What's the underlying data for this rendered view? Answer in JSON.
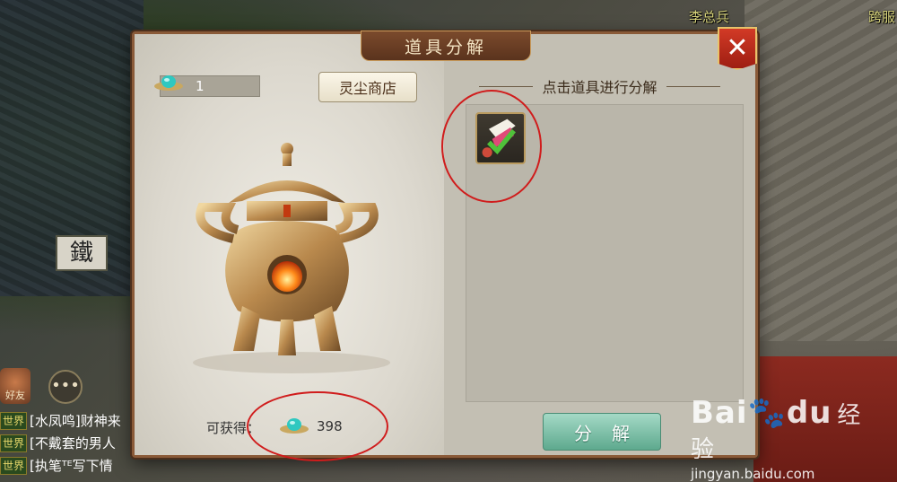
{
  "world": {
    "sign_char": "鐵",
    "npc_names": [
      "李总兵",
      "跨服"
    ]
  },
  "chat": {
    "friends_label": "好友",
    "lines": [
      {
        "tag": "世界",
        "text": "[水凤鸣]财神来"
      },
      {
        "tag": "世界",
        "text": "[不戴套的男人"
      },
      {
        "tag": "世界",
        "text": "[执笔ᵀᴱ写下情"
      }
    ]
  },
  "dialog": {
    "title": "道具分解",
    "close_label": "✕",
    "dust_count": "1",
    "shop_button": "灵尘商店",
    "gain_label": "可获得：",
    "gain_value": "398",
    "hint": "点击道具进行分解",
    "split_button": "分解"
  },
  "watermark": {
    "logo": "Bai",
    "logo_suffix": "du",
    "text": "经验",
    "url": "jingyan.baidu.com"
  },
  "colors": {
    "accent_red": "#d01c1c",
    "title_brown": "#5a331d",
    "split_green": "#5ea98e"
  }
}
